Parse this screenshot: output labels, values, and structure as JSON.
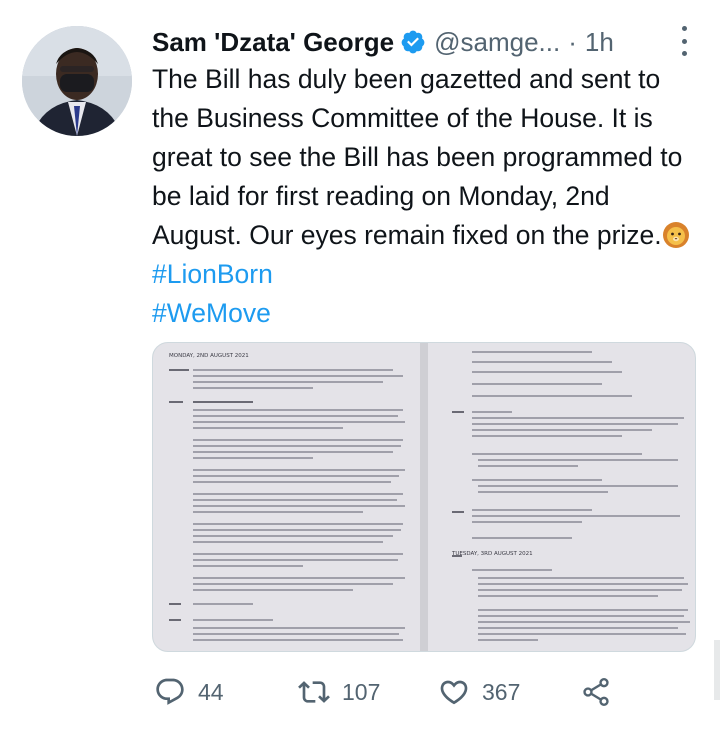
{
  "tweet": {
    "author_name": "Sam 'Dzata' George",
    "handle": "@samge...",
    "separator": "·",
    "time": "1h",
    "text_main": "The Bill has duly been gazetted and sent to the Business Committee of the House. It is great to see the Bill has been programmed to be laid for first reading on Monday, 2nd August. Our eyes remain fixed on the prize.",
    "emoji": "lion-face-emoji",
    "hashtags": [
      "#LionBorn",
      "#WeMove"
    ]
  },
  "media": {
    "left_doc": {
      "heading": "MONDAY, 2ND AUGUST 2021"
    },
    "right_doc": {
      "heading": "TUESDAY, 3RD AUGUST 2021"
    }
  },
  "actions": {
    "reply_count": "44",
    "retweet_count": "107",
    "like_count": "367"
  },
  "icons": {
    "verified": "verified-badge-icon",
    "more": "more-options-icon",
    "reply": "reply-icon",
    "retweet": "retweet-icon",
    "like": "heart-icon",
    "share": "share-icon"
  },
  "colors": {
    "accent": "#1d9bf0",
    "text": "#0f1419",
    "secondary": "#536471"
  }
}
